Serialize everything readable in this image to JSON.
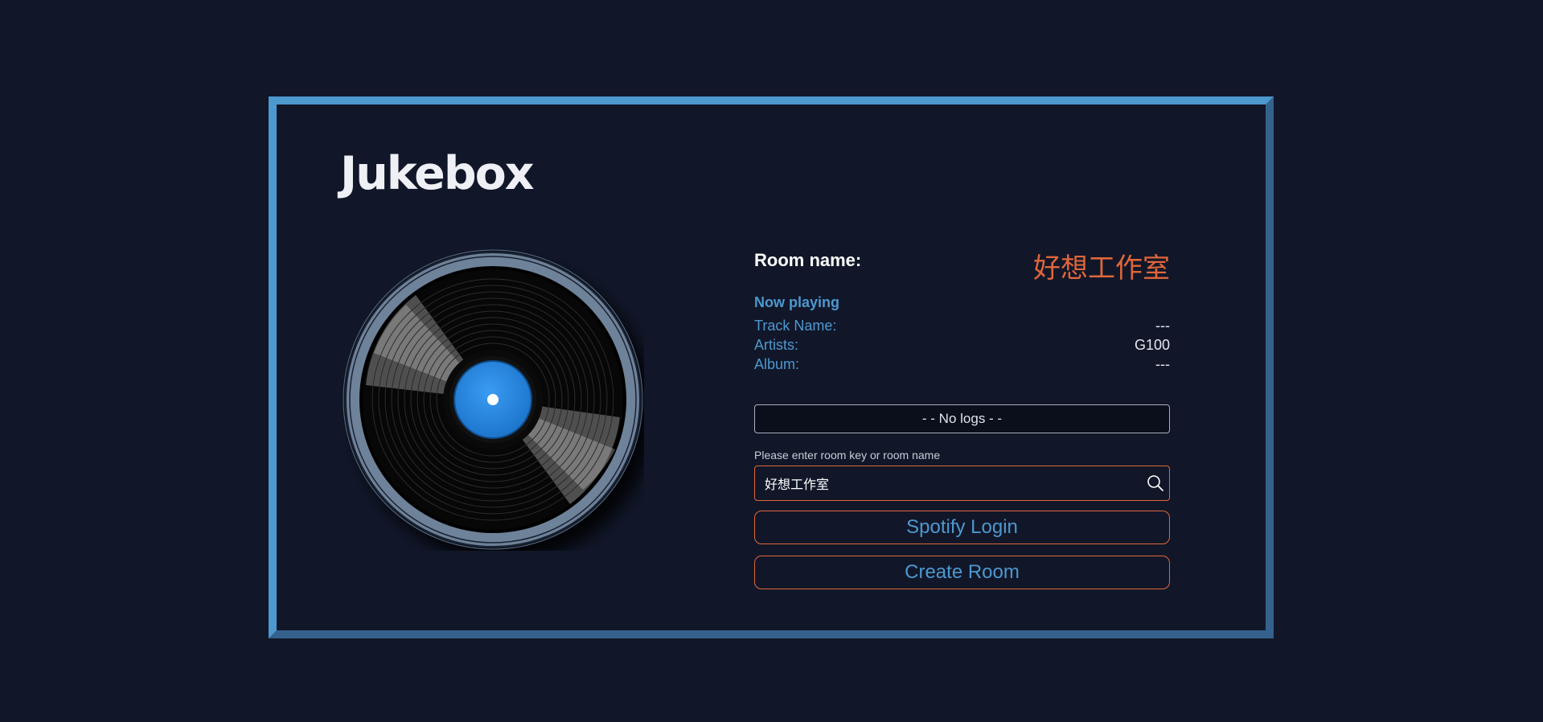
{
  "app": {
    "title": "Jukebox"
  },
  "room": {
    "label": "Room name:",
    "name": "好想工作室"
  },
  "now_playing": {
    "heading": "Now playing",
    "rows": [
      {
        "label": "Track Name:",
        "value": "---"
      },
      {
        "label": "Artists:",
        "value": "G100"
      },
      {
        "label": "Album:",
        "value": "---"
      }
    ]
  },
  "logs": {
    "text": "- - No logs - -"
  },
  "search": {
    "hint": "Please enter room key or room name",
    "value": "好想工作室",
    "icon": "search-icon"
  },
  "buttons": {
    "spotify_login": "Spotify Login",
    "create_room": "Create Room"
  },
  "colors": {
    "background": "#111729",
    "frame_light": "#4d98cf",
    "frame_dark": "#34628c",
    "accent_orange": "#e0663a",
    "accent_blue": "#4d98cf",
    "record_label": "#1f83e0"
  }
}
